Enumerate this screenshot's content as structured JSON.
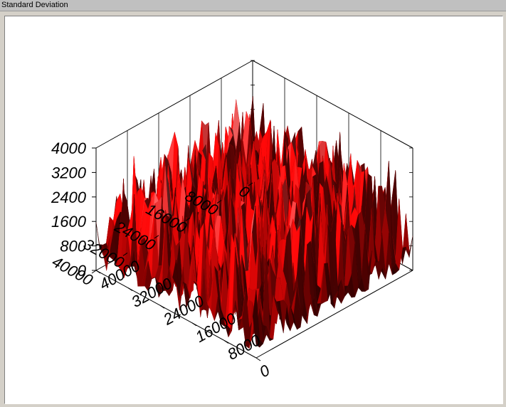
{
  "window": {
    "title": "Standard Deviation"
  },
  "chart_data": {
    "type": "surface",
    "title": "",
    "xlabel": "",
    "ylabel": "",
    "zlabel": "",
    "x_ticks": [
      "0",
      "8000",
      "16000",
      "24000",
      "32000",
      "40000"
    ],
    "y_ticks": [
      "0",
      "8000",
      "16000",
      "24000",
      "32000",
      "40000"
    ],
    "z_ticks": [
      "0",
      "800",
      "1600",
      "2400",
      "3200",
      "4000"
    ],
    "xlim": [
      0,
      40000
    ],
    "ylim": [
      0,
      40000
    ],
    "zlim": [
      0,
      4000
    ],
    "color_low": "#000000",
    "color_high": "#ff0000",
    "color_peak": "#ffc0c0",
    "surface_summary": {
      "baseline_typical": 400,
      "peak_typical": 2600,
      "peak_max": 3800
    }
  }
}
